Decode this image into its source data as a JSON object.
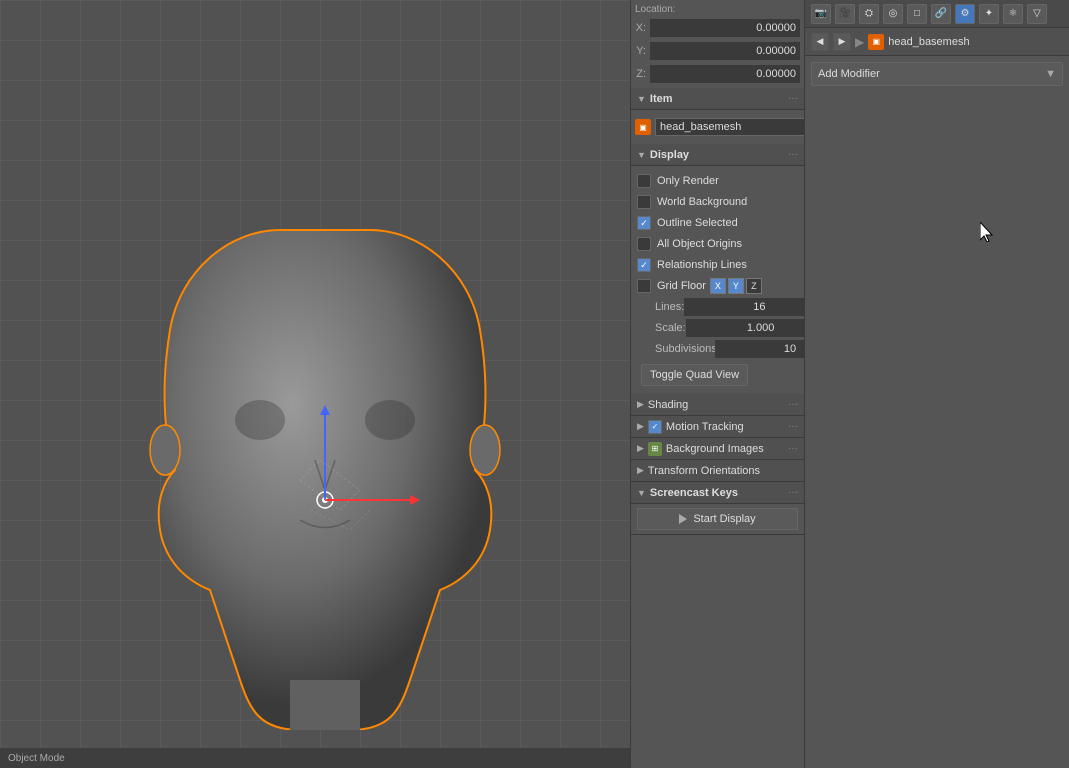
{
  "viewport": {
    "label": "3D Viewport"
  },
  "location": {
    "x_label": "X:",
    "x_value": "0.00000",
    "y_label": "Y:",
    "y_value": "0.00000",
    "z_label": "Z:",
    "z_value": "0.00000"
  },
  "item_section": {
    "title": "Item",
    "object_name": "head_basemesh"
  },
  "display_section": {
    "title": "Display",
    "only_render": {
      "label": "Only Render",
      "checked": false
    },
    "world_background": {
      "label": "World Background",
      "checked": false
    },
    "outline_selected": {
      "label": "Outline Selected",
      "checked": true
    },
    "all_object_origins": {
      "label": "All Object Origins",
      "checked": false
    },
    "relationship_lines": {
      "label": "Relationship Lines",
      "checked": true
    },
    "grid_floor": {
      "label": "Grid Floor"
    },
    "axis_x": "X",
    "axis_y": "Y",
    "axis_z": "Z",
    "lines_label": "Lines:",
    "lines_value": "16",
    "scale_label": "Scale:",
    "scale_value": "1.000",
    "subdivisions_label": "Subdivisions:",
    "subdivisions_value": "10",
    "toggle_quad_view": "Toggle Quad View"
  },
  "shading_section": {
    "title": "Shading"
  },
  "motion_tracking_section": {
    "title": "Motion Tracking",
    "checked": true
  },
  "background_images_section": {
    "title": "Background Images",
    "checked": false
  },
  "transform_orientations_section": {
    "title": "Transform Orientations"
  },
  "screencast_keys_section": {
    "title": "Screencast Keys",
    "start_display": "Start Display"
  },
  "modifiers_panel": {
    "object_name": "head_basemesh",
    "add_modifier_label": "Add Modifier"
  },
  "toolbar": {
    "icons": [
      "render",
      "camera",
      "scene",
      "world",
      "object",
      "constraint",
      "modifier",
      "particles",
      "physics",
      "data"
    ]
  }
}
